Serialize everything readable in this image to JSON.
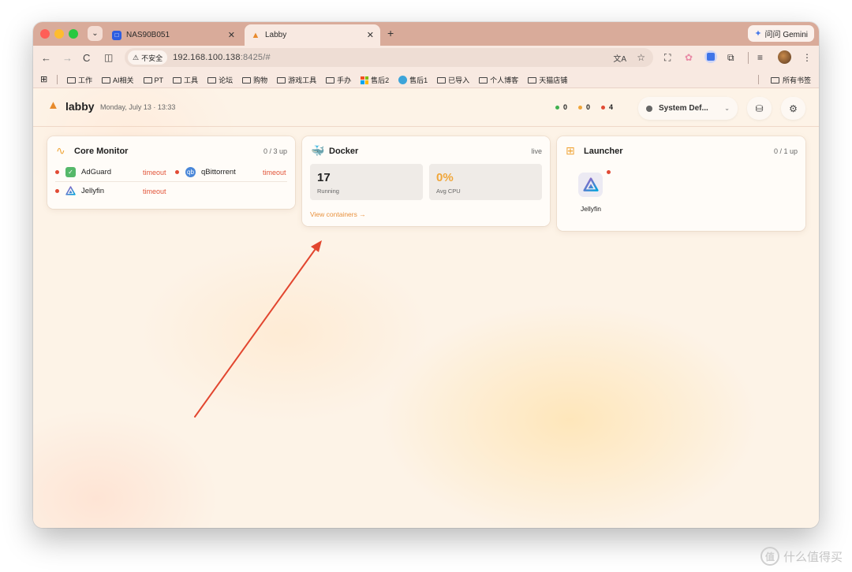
{
  "browser": {
    "tabs": [
      {
        "title": "NAS90B051"
      },
      {
        "title": "Labby"
      }
    ],
    "new_tab": "+",
    "gemini_label": "问问 Gemini",
    "security_label": "不安全",
    "url_host": "192.168.100.138",
    "url_rest": ":8425/#",
    "bookmarks": [
      {
        "label": "工作",
        "icon": "folder"
      },
      {
        "label": "AI相关",
        "icon": "folder"
      },
      {
        "label": "PT",
        "icon": "folder"
      },
      {
        "label": "工具",
        "icon": "folder"
      },
      {
        "label": "论坛",
        "icon": "folder"
      },
      {
        "label": "购物",
        "icon": "folder"
      },
      {
        "label": "游戏工具",
        "icon": "folder"
      },
      {
        "label": "手办",
        "icon": "folder"
      },
      {
        "label": "售后2",
        "icon": "windows-logo"
      },
      {
        "label": "售后1",
        "icon": "globe"
      },
      {
        "label": "已导入",
        "icon": "folder"
      },
      {
        "label": "个人博客",
        "icon": "folder"
      },
      {
        "label": "天猫店铺",
        "icon": "folder"
      }
    ],
    "all_bookmarks_label": "所有书签"
  },
  "app": {
    "brand": "labby",
    "datetime": "Monday, July 13 · 13:33",
    "counters": [
      {
        "value": "0",
        "color": "#3fb04f"
      },
      {
        "value": "0",
        "color": "#f0a63a"
      },
      {
        "value": "4",
        "color": "#e14a34"
      }
    ],
    "theme_label": "System Def...",
    "accent": "#e8913d"
  },
  "core_monitor": {
    "title": "Core Monitor",
    "meta": "0 / 3 up",
    "services": [
      {
        "name": "AdGuard",
        "status": "timeout"
      },
      {
        "name": "qBittorrent",
        "status": "timeout",
        "icon_text": "qb"
      },
      {
        "name": "Jellyfin",
        "status": "timeout"
      }
    ]
  },
  "docker": {
    "title": "Docker",
    "meta": "live",
    "running_value": "17",
    "running_label": "Running",
    "cpu_value": "0%",
    "cpu_label": "Avg CPU",
    "view_link": "View containers →"
  },
  "launcher": {
    "title": "Launcher",
    "meta": "0 / 1 up",
    "items": [
      {
        "name": "Jellyfin"
      }
    ]
  },
  "watermark": {
    "text": "什么值得买",
    "icon_text": "值"
  }
}
